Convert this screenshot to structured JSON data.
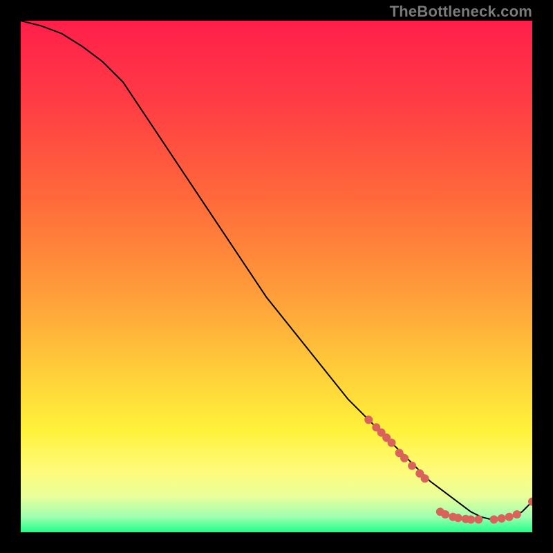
{
  "watermark": "TheBottleneck.com",
  "colors": {
    "background": "#000000",
    "line": "#000000",
    "marker": "#d9635b",
    "gradient_stops": [
      {
        "offset": 0.0,
        "color": "#ff1f4a"
      },
      {
        "offset": 0.15,
        "color": "#ff3a45"
      },
      {
        "offset": 0.35,
        "color": "#ff6a3a"
      },
      {
        "offset": 0.55,
        "color": "#ffa23a"
      },
      {
        "offset": 0.7,
        "color": "#ffd23a"
      },
      {
        "offset": 0.8,
        "color": "#fff13a"
      },
      {
        "offset": 0.88,
        "color": "#fffb7a"
      },
      {
        "offset": 0.93,
        "color": "#e9ff9a"
      },
      {
        "offset": 0.97,
        "color": "#9fffb0"
      },
      {
        "offset": 1.0,
        "color": "#1eff8a"
      }
    ]
  },
  "chart_data": {
    "type": "line",
    "title": "",
    "xlabel": "",
    "ylabel": "",
    "xlim": [
      0,
      100
    ],
    "ylim": [
      0,
      100
    ],
    "series": [
      {
        "name": "curve",
        "x": [
          0,
          4,
          8,
          12,
          16,
          20,
          24,
          28,
          32,
          36,
          40,
          44,
          48,
          52,
          56,
          60,
          64,
          68,
          72,
          76,
          80,
          82,
          84,
          86,
          88,
          90,
          92,
          94,
          96,
          98,
          100
        ],
        "y": [
          100,
          99,
          97.5,
          95,
          92,
          88,
          82,
          76,
          70,
          64,
          58,
          52,
          46,
          41,
          36,
          31,
          26,
          22,
          18,
          14,
          10,
          8.5,
          7,
          5.5,
          4,
          3,
          2.5,
          2.5,
          3,
          4,
          6
        ]
      }
    ],
    "markers": [
      {
        "x": 68,
        "y": 22
      },
      {
        "x": 69.5,
        "y": 20.5
      },
      {
        "x": 70.5,
        "y": 19.5
      },
      {
        "x": 71.5,
        "y": 18.5
      },
      {
        "x": 72.5,
        "y": 17.5
      },
      {
        "x": 74,
        "y": 15.5
      },
      {
        "x": 75,
        "y": 14.5
      },
      {
        "x": 76.5,
        "y": 13
      },
      {
        "x": 78,
        "y": 11.5
      },
      {
        "x": 79,
        "y": 10.5
      },
      {
        "x": 82,
        "y": 4.0
      },
      {
        "x": 83,
        "y": 3.5
      },
      {
        "x": 84.5,
        "y": 3.0
      },
      {
        "x": 85.5,
        "y": 2.8
      },
      {
        "x": 87,
        "y": 2.6
      },
      {
        "x": 88,
        "y": 2.5
      },
      {
        "x": 89.5,
        "y": 2.5
      },
      {
        "x": 92.5,
        "y": 2.5
      },
      {
        "x": 94,
        "y": 2.7
      },
      {
        "x": 95.5,
        "y": 3.0
      },
      {
        "x": 97,
        "y": 3.5
      },
      {
        "x": 100,
        "y": 6.0
      }
    ],
    "marker_radius_px": 6
  }
}
